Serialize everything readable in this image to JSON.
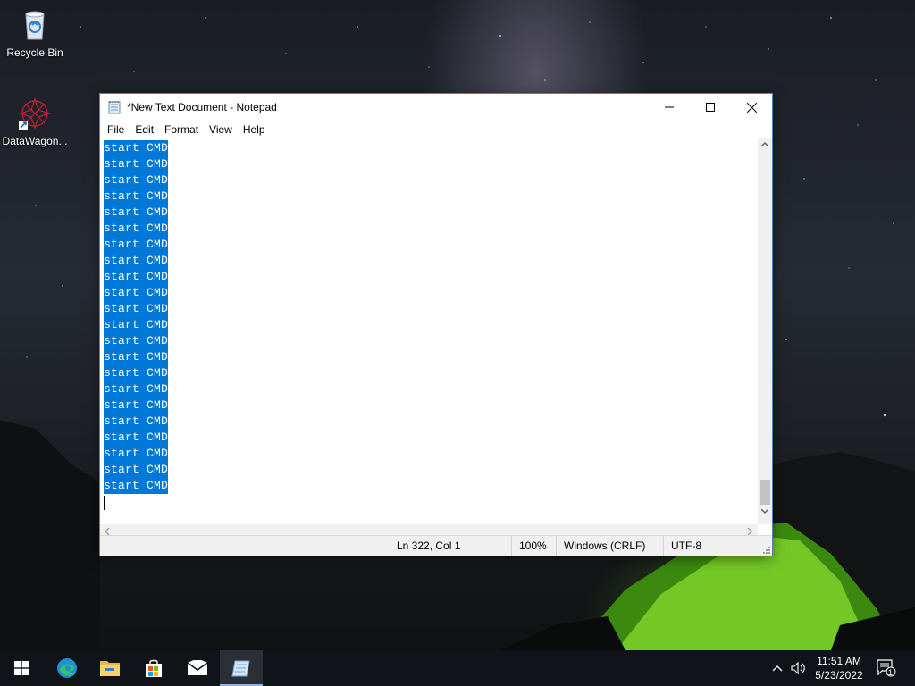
{
  "desktop": {
    "icons": [
      {
        "label": "Recycle Bin",
        "icon": "recycle-bin-icon"
      },
      {
        "label": "DataWagon...",
        "icon": "datawagon-shortcut-icon"
      }
    ]
  },
  "notepad": {
    "title": "*New Text Document - Notepad",
    "menu": [
      "File",
      "Edit",
      "Format",
      "View",
      "Help"
    ],
    "lines": [
      "start CMD",
      "start CMD",
      "start CMD",
      "start CMD",
      "start CMD",
      "start CMD",
      "start CMD",
      "start CMD",
      "start CMD",
      "start CMD",
      "start CMD",
      "start CMD",
      "start CMD",
      "start CMD",
      "start CMD",
      "start CMD",
      "start CMD",
      "start CMD",
      "start CMD",
      "start CMD",
      "start CMD",
      "start CMD"
    ],
    "selection_color": "#0078d7",
    "status": {
      "position": "Ln 322, Col 1",
      "zoom": "100%",
      "line_ending": "Windows (CRLF)",
      "encoding": "UTF-8"
    }
  },
  "taskbar": {
    "apps": [
      "start-icon",
      "edge-icon",
      "file-explorer-icon",
      "store-icon",
      "mail-icon",
      "notepad-icon"
    ],
    "clock": {
      "time": "11:51 AM",
      "date": "5/23/2022"
    },
    "notification_count": "1"
  }
}
